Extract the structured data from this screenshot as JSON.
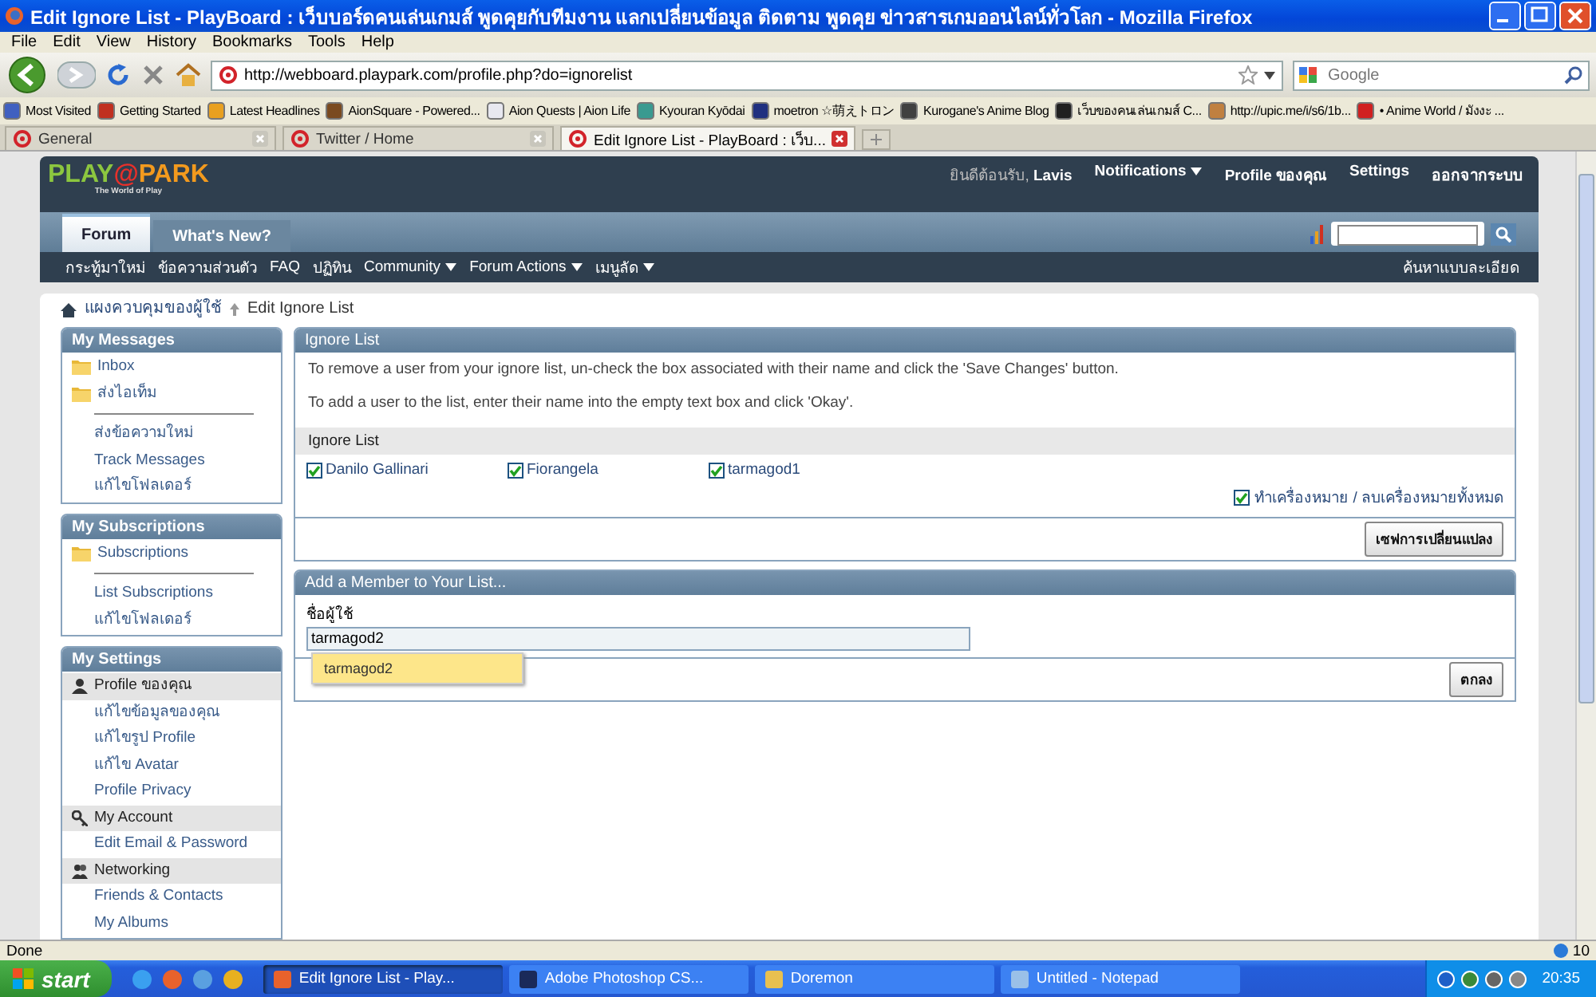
{
  "window": {
    "title": "Edit Ignore List - PlayBoard : เว็บบอร์ดคนเล่นเกมส์ พูดคุยกับทีมงาน แลกเปลี่ยนข้อมูล ติดตาม พูดคุย ข่าวสารเกมออนไลน์ทั่วโลก - Mozilla Firefox"
  },
  "menu_bar": [
    "File",
    "Edit",
    "View",
    "History",
    "Bookmarks",
    "Tools",
    "Help"
  ],
  "address_bar": {
    "url": "http://webboard.playpark.com/profile.php?do=ignorelist"
  },
  "search_box": {
    "placeholder": "Google"
  },
  "bookmarks": [
    "Most Visited",
    "Getting Started",
    "Latest Headlines",
    "AionSquare - Powered...",
    "Aion Quests | Aion Life",
    "Kyouran Kyōdai",
    "moetron ☆萌えトロン",
    "Kurogane's Anime Blog",
    "เว็บของคนเล่นเกมส์ C...",
    "http://upic.me/i/s6/1b...",
    "• Anime World / มังงะ ..."
  ],
  "browser_tabs": [
    {
      "label": "General",
      "selected": false
    },
    {
      "label": "Twitter / Home",
      "selected": false
    },
    {
      "label": "Edit Ignore List - PlayBoard : เว็บ...",
      "selected": true
    }
  ],
  "site_header": {
    "logo_left": "PLAY",
    "logo_at": "@",
    "logo_right": "PARK",
    "tagline": "The World of Play",
    "welcome": "ยินดีต้อนรับ,",
    "username": "Lavis",
    "links": [
      {
        "label": "Notifications",
        "dropdown": true
      },
      {
        "label": "Profile ของคุณ",
        "dropdown": false
      },
      {
        "label": "Settings",
        "dropdown": false
      },
      {
        "label": "ออกจากระบบ",
        "dropdown": false
      }
    ]
  },
  "forum_tabs": [
    {
      "label": "Forum",
      "selected": true
    },
    {
      "label": "What's New?",
      "selected": false
    }
  ],
  "nav_links": [
    {
      "label": "กระทู้มาใหม่",
      "dropdown": false
    },
    {
      "label": "ข้อความส่วนตัว",
      "dropdown": false
    },
    {
      "label": "FAQ",
      "dropdown": false
    },
    {
      "label": "ปฏิทิน",
      "dropdown": false
    },
    {
      "label": "Community",
      "dropdown": true
    },
    {
      "label": "Forum Actions",
      "dropdown": true
    },
    {
      "label": "เมนูลัด",
      "dropdown": true
    }
  ],
  "advanced_search": "ค้นหาแบบละเอียด",
  "breadcrumb": [
    "แผงควบคุมของผู้ใช้",
    "Edit Ignore List"
  ],
  "sidebar": [
    {
      "title": "My Messages",
      "items": [
        {
          "kind": "folder",
          "label": "Inbox"
        },
        {
          "kind": "folder",
          "label": "ส่งไอเท็ม"
        },
        {
          "kind": "divider"
        },
        {
          "kind": "link",
          "label": "ส่งข้อความใหม่"
        },
        {
          "kind": "link",
          "label": "Track Messages"
        },
        {
          "kind": "link",
          "label": "แก้ไขโฟลเดอร์"
        }
      ]
    },
    {
      "title": "My Subscriptions",
      "items": [
        {
          "kind": "folder",
          "label": "Subscriptions"
        },
        {
          "kind": "divider"
        },
        {
          "kind": "link",
          "label": "List Subscriptions"
        },
        {
          "kind": "link",
          "label": "แก้ไขโฟลเดอร์"
        }
      ]
    },
    {
      "title": "My Settings",
      "items": [
        {
          "kind": "group",
          "label": "Profile ของคุณ"
        },
        {
          "kind": "link",
          "label": "แก้ไขข้อมูลของคุณ"
        },
        {
          "kind": "link",
          "label": "แก้ไขรูป Profile"
        },
        {
          "kind": "link",
          "label": "แก้ไข Avatar"
        },
        {
          "kind": "link",
          "label": "Profile Privacy"
        },
        {
          "kind": "group",
          "label": "My Account"
        },
        {
          "kind": "link",
          "label": "Edit Email & Password"
        },
        {
          "kind": "group",
          "label": "Networking"
        },
        {
          "kind": "link",
          "label": "Friends & Contacts"
        },
        {
          "kind": "link",
          "label": "My Albums"
        }
      ]
    }
  ],
  "ignore_panel": {
    "title": "Ignore List",
    "instructions": [
      "To remove a user from your ignore list, un-check the box associated with their name and click the 'Save Changes' button.",
      "To add a user to the list, enter their name into the empty text box and click 'Okay'."
    ],
    "list_title": "Ignore List",
    "users": [
      {
        "name": "Danilo Gallinari",
        "checked": true
      },
      {
        "name": "Fiorangela",
        "checked": true
      },
      {
        "name": "tarmagod1",
        "checked": true
      }
    ],
    "select_all": {
      "label": "ทำเครื่องหมาย / ลบเครื่องหมายทั้งหมด",
      "checked": true
    },
    "save_button": "เซฟการเปลี่ยนแปลง"
  },
  "add_panel": {
    "title": "Add a Member to Your List...",
    "field_label": "ชื่อผู้ใช้",
    "value": "tarmagod2",
    "suggestion": "tarmagod2",
    "ok_button": "ตกลง"
  },
  "status_bar": {
    "text": "Done",
    "badge": "10"
  },
  "taskbar": {
    "start": "start",
    "windows": [
      {
        "label": "Edit Ignore List - Play...",
        "selected": true
      },
      {
        "label": "Adobe Photoshop CS...",
        "selected": false
      },
      {
        "label": "Doremon",
        "selected": false
      },
      {
        "label": "Untitled - Notepad",
        "selected": false
      }
    ],
    "clock": "20:35"
  }
}
